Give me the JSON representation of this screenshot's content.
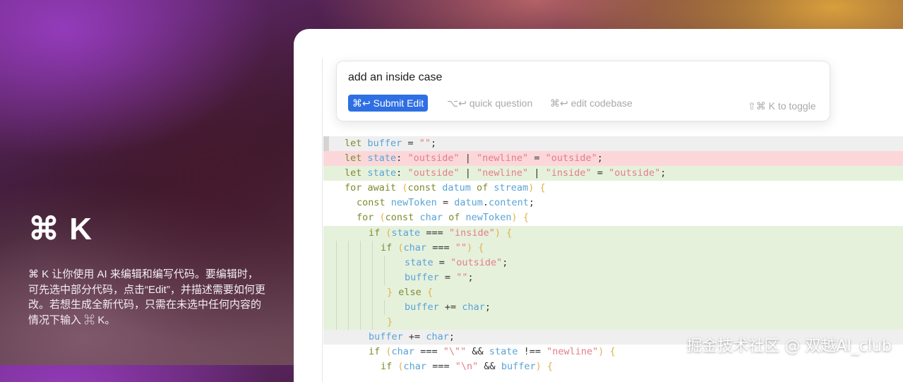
{
  "sidebar": {
    "title": "⌘ K",
    "description": "⌘ K 让你使用 AI 来编辑和编写代码。要编辑时，可先选中部分代码，点击“Edit”，并描述需要如何更改。若想生成全新代码，只需在未选中任何内容的情况下输入 ⌘ K。"
  },
  "prompt": {
    "input_text": "add an inside case",
    "submit_label": "⌘↩ Submit Edit",
    "quick_question": "⌥↩ quick question",
    "edit_codebase": "⌘↩ edit codebase",
    "toggle_hint": "⇧⌘ K to toggle"
  },
  "code": {
    "l1": "let buffer = \"\";",
    "l2": "let state: \"outside\" | \"newline\" = \"outside\";",
    "l3": "let state: \"outside\" | \"newline\" | \"inside\" = \"outside\";",
    "l4": "for await (const datum of stream) {",
    "l5": "const newToken = datum.content;",
    "l6": "for (const char of newToken) {",
    "l7": "if (state === \"inside\") {",
    "l8": "if (char === \"\") {",
    "l9": "state = \"outside\";",
    "l10": "buffer = \"\";",
    "l11": "} else {",
    "l12": "buffer += char;",
    "l13": "}",
    "l14": "buffer += char;",
    "l15": "if (char === \"\\\"\" && state !== \"newline\") {",
    "l16": "if (char === \"\\n\" && buffer) {"
  },
  "watermark": "掘金技术社区 @ 双越AI_club"
}
